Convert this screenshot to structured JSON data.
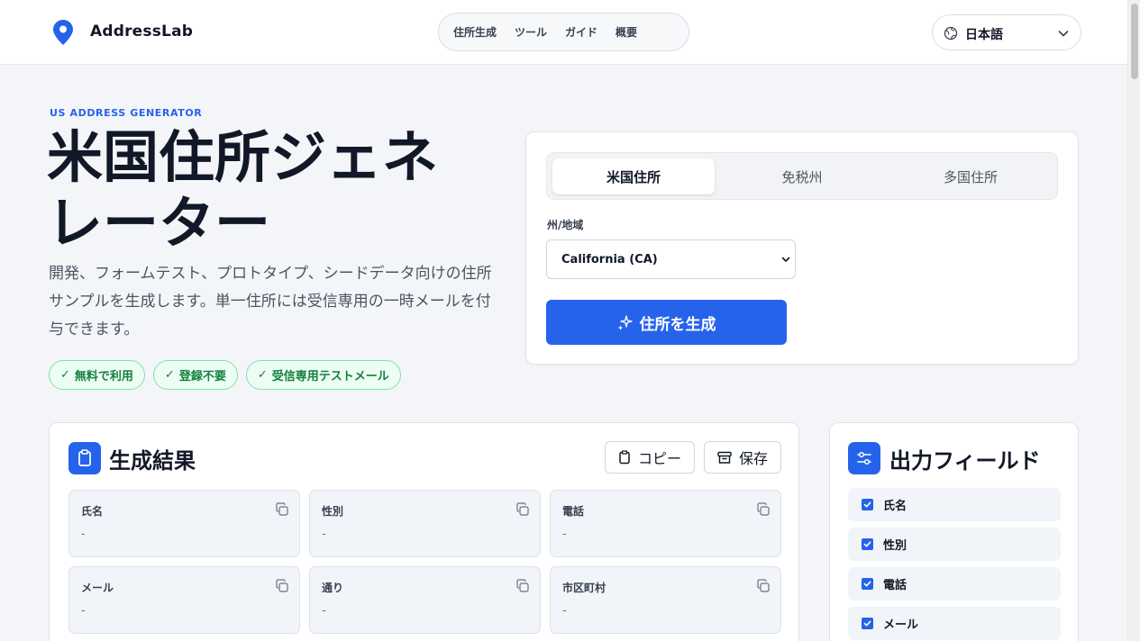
{
  "header": {
    "logo_text": "AddressLab",
    "nav": [
      "住所生成",
      "ツール",
      "ガイド",
      "概要"
    ],
    "language": "日本語"
  },
  "hero": {
    "eyebrow": "US ADDRESS GENERATOR",
    "title": "米国住所ジェネレーター",
    "description": "開発、フォームテスト、プロトタイプ、シードデータ向けの住所サンプルを生成します。単一住所には受信専用の一時メールを付与できます。",
    "badges": [
      "無料で利用",
      "登録不要",
      "受信専用テストメール"
    ]
  },
  "generator": {
    "tabs": [
      "米国住所",
      "免税州",
      "多国住所"
    ],
    "active_tab": "米国住所",
    "state_label": "州/地域",
    "state_value": "California (CA)",
    "generate_button": "住所を生成"
  },
  "results": {
    "title": "生成結果",
    "copy_button": "コピー",
    "save_button": "保存",
    "fields": [
      {
        "name": "氏名",
        "value": "-"
      },
      {
        "name": "性別",
        "value": "-"
      },
      {
        "name": "電話",
        "value": "-"
      },
      {
        "name": "メール",
        "value": "-"
      },
      {
        "name": "通り",
        "value": "-"
      },
      {
        "name": "市区町村",
        "value": "-"
      }
    ]
  },
  "output_fields": {
    "title": "出力フィールド",
    "items": [
      {
        "label": "氏名",
        "checked": true
      },
      {
        "label": "性別",
        "checked": true
      },
      {
        "label": "電話",
        "checked": true
      },
      {
        "label": "メール",
        "checked": true
      }
    ]
  },
  "colors": {
    "accent": "#2563eb",
    "badge_green": "#15803d",
    "background": "#f3f5f8"
  }
}
